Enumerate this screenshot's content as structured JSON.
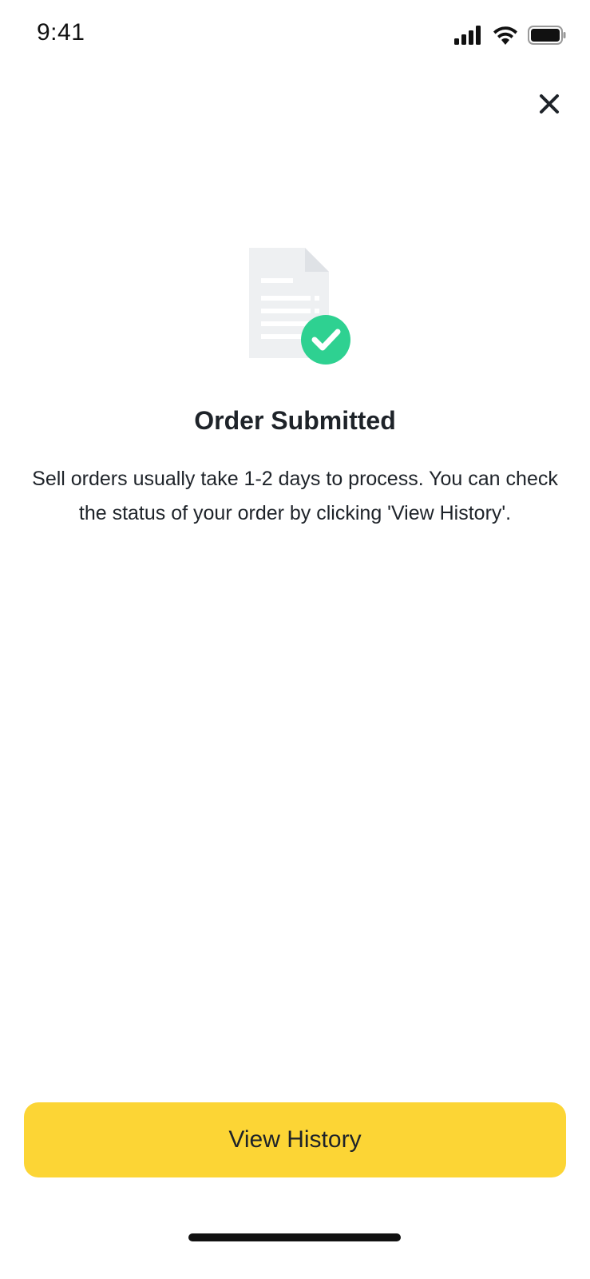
{
  "status_bar": {
    "time": "9:41",
    "icons": [
      "cellular-signal-icon",
      "wifi-icon",
      "battery-icon"
    ]
  },
  "header": {
    "close_icon": "close-icon"
  },
  "illustration": {
    "icon": "document-check-icon",
    "colors": {
      "document": "#eef0f2",
      "document_fold": "#dfe2e6",
      "lines": "#ffffff",
      "check_badge": "#2ed191"
    }
  },
  "content": {
    "title": "Order Submitted",
    "description": "Sell orders usually take 1-2 days to process. You can check the status of your order by clicking 'View History'."
  },
  "actions": {
    "primary_label": "View History"
  },
  "colors": {
    "accent": "#fcd535",
    "text": "#1e2329",
    "background": "#ffffff"
  }
}
